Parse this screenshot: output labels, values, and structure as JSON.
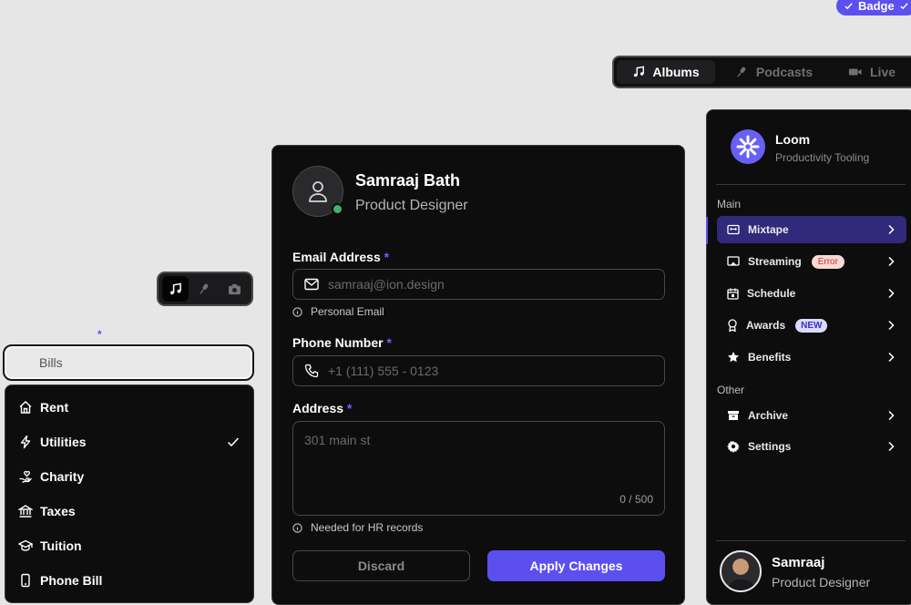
{
  "badge": {
    "label": "Badge"
  },
  "media_tabs": {
    "items": [
      {
        "label": "Albums",
        "icon": "music-note-icon",
        "active": true
      },
      {
        "label": "Podcasts",
        "icon": "microphone-icon",
        "active": false
      },
      {
        "label": "Live",
        "icon": "video-camera-icon",
        "active": false
      }
    ]
  },
  "icon_toggle": {
    "items": [
      {
        "icon": "music-note-icon",
        "active": true
      },
      {
        "icon": "microphone-icon",
        "active": false
      },
      {
        "icon": "camera-icon",
        "active": false
      }
    ]
  },
  "bill_select": {
    "required_mark": "*",
    "value": "Bills",
    "options": [
      {
        "label": "Rent",
        "icon": "house-icon",
        "selected": false
      },
      {
        "label": "Utilities",
        "icon": "lightning-icon",
        "selected": true
      },
      {
        "label": "Charity",
        "icon": "hand-heart-icon",
        "selected": false
      },
      {
        "label": "Taxes",
        "icon": "bank-icon",
        "selected": false
      },
      {
        "label": "Tuition",
        "icon": "graduation-cap-icon",
        "selected": false
      },
      {
        "label": "Phone Bill",
        "icon": "phone-device-icon",
        "selected": false
      }
    ]
  },
  "profile": {
    "name": "Samraaj Bath",
    "role": "Product Designer",
    "email": {
      "label": "Email Address",
      "required": "*",
      "placeholder": "samraaj@ion.design",
      "hint": "Personal Email"
    },
    "phone": {
      "label": "Phone Number",
      "required": "*",
      "placeholder": "+1 (111) 555 - 0123"
    },
    "address": {
      "label": "Address",
      "required": "*",
      "placeholder": "301 main st",
      "counter": "0 / 500",
      "hint": "Needed for HR records"
    },
    "discard_label": "Discard",
    "apply_label": "Apply Changes",
    "accent": "#5b4ff0"
  },
  "sidebar": {
    "brand": {
      "name": "Loom",
      "subtitle": "Productivity Tooling"
    },
    "sections": [
      {
        "title": "Main",
        "items": [
          {
            "label": "Mixtape",
            "icon": "cassette-icon",
            "active": true
          },
          {
            "label": "Streaming",
            "icon": "cast-icon",
            "tag": "Error"
          },
          {
            "label": "Schedule",
            "icon": "calendar-icon"
          },
          {
            "label": "Awards",
            "icon": "award-icon",
            "tag": "NEW"
          },
          {
            "label": "Benefits",
            "icon": "star-icon"
          }
        ]
      },
      {
        "title": "Other",
        "items": [
          {
            "label": "Archive",
            "icon": "archive-icon"
          },
          {
            "label": "Settings",
            "icon": "gear-icon"
          }
        ]
      }
    ],
    "user": {
      "name": "Samraaj",
      "role": "Product Designer"
    }
  }
}
